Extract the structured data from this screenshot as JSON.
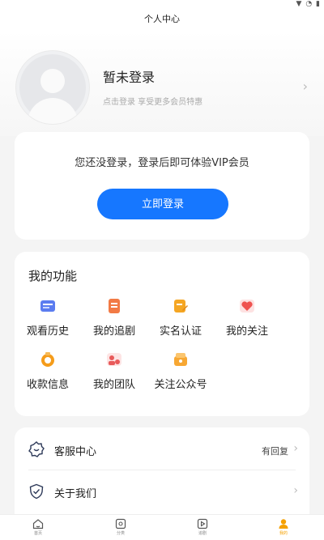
{
  "header": {
    "title": "个人中心"
  },
  "profile": {
    "name": "暂未登录",
    "subtitle": "点击登录 享受更多会员特惠",
    "chevron": "›"
  },
  "vip": {
    "text": "您还没登录，登录后即可体验VIP会员",
    "button_label": "立即登录",
    "accent": "#1677ff"
  },
  "features": {
    "title": "我的功能",
    "items": [
      {
        "label": "观看历史",
        "icon": "history-icon",
        "color": "#5b7cf0"
      },
      {
        "label": "我的追剧",
        "icon": "following-drama-icon",
        "color": "#f27a45"
      },
      {
        "label": "实名认证",
        "icon": "verify-icon",
        "color": "#f5a623"
      },
      {
        "label": "我的关注",
        "icon": "heart-icon",
        "color": "#ef5350"
      },
      {
        "label": "收款信息",
        "icon": "payment-icon",
        "color": "#f59c1a"
      },
      {
        "label": "我的团队",
        "icon": "team-icon",
        "color": "#e85a5a"
      },
      {
        "label": "关注公众号",
        "icon": "official-account-icon",
        "color": "#f7a733"
      }
    ]
  },
  "menu": {
    "items": [
      {
        "label": "客服中心",
        "right": "有回复",
        "icon": "customer-service-icon"
      },
      {
        "label": "关于我们",
        "right": "",
        "icon": "shield-icon"
      }
    ],
    "chevron": "›"
  },
  "tabbar": {
    "tabs": [
      {
        "label": "首页",
        "icon": "home-icon",
        "active": false
      },
      {
        "label": "分类",
        "icon": "category-icon",
        "active": false
      },
      {
        "label": "追剧",
        "icon": "play-icon",
        "active": false
      },
      {
        "label": "我的",
        "icon": "profile-icon",
        "active": true
      }
    ],
    "active_color": "#f5a100"
  }
}
